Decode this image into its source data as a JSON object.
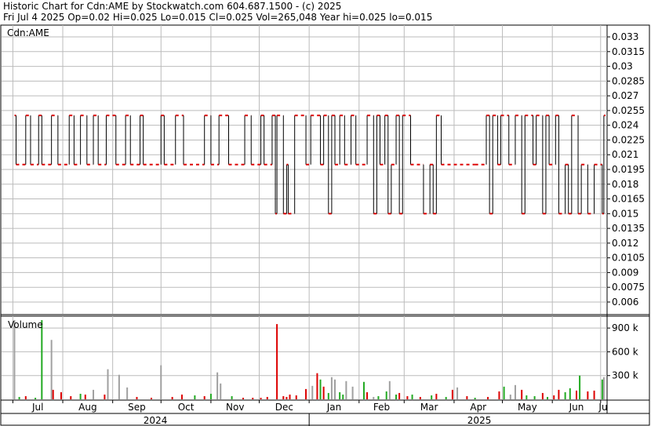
{
  "header": {
    "title_line": "Historic Chart for Cdn:AME by Stockwatch.com 604.687.1500 - (c) 2025",
    "stats_line": "Fri Jul  4 2025   Op=0.02   Hi=0.025   Lo=0.015   Cl=0.025   Vol=265,048   Year hi=0.025   lo=0.015"
  },
  "colors": {
    "up": "#dd0000",
    "down": "#000000",
    "vol_up": "#22aa22",
    "vol_down": "#dd0000",
    "vol_flat": "#a0a0a0",
    "grid": "#bbbbbb"
  },
  "chart_data": {
    "type": "ohlc",
    "symbol_label": "Cdn:AME",
    "price_axis": {
      "ticks": [
        "0.033",
        "0.0315",
        "0.03",
        "0.0285",
        "0.027",
        "0.0255",
        "0.024",
        "0.0225",
        "0.021",
        "0.0195",
        "0.018",
        "0.0165",
        "0.015",
        "0.0135",
        "0.012",
        "0.0105",
        "0.009",
        "0.0075",
        "0.006"
      ],
      "range": [
        0.0048,
        0.0342
      ]
    },
    "volume_axis": {
      "label": "Volume",
      "ticks": [
        "900 k",
        "600 k",
        "300 k"
      ],
      "range": [
        0,
        1050000
      ]
    },
    "months": [
      "Jul",
      "Aug",
      "Sep",
      "Oct",
      "Nov",
      "Dec",
      "Jan",
      "Feb",
      "Mar",
      "Apr",
      "May",
      "Jun",
      "Ju"
    ],
    "years": [
      "2024",
      "2025"
    ],
    "price_levels": [
      0.015,
      0.02,
      0.025
    ],
    "price_path": [
      [
        "2024-07-02",
        0.025
      ],
      [
        "2024-07-03",
        0.02
      ],
      [
        "2024-07-09",
        0.025
      ],
      [
        "2024-07-12",
        0.02
      ],
      [
        "2024-07-17",
        0.025
      ],
      [
        "2024-07-19",
        0.02
      ],
      [
        "2024-07-25",
        0.025
      ],
      [
        "2024-07-29",
        0.02
      ],
      [
        "2024-08-05",
        0.025
      ],
      [
        "2024-08-08",
        0.02
      ],
      [
        "2024-08-12",
        0.025
      ],
      [
        "2024-08-16",
        0.02
      ],
      [
        "2024-08-20",
        0.025
      ],
      [
        "2024-08-23",
        0.02
      ],
      [
        "2024-08-28",
        0.025
      ],
      [
        "2024-09-03",
        0.02
      ],
      [
        "2024-09-09",
        0.025
      ],
      [
        "2024-09-12",
        0.02
      ],
      [
        "2024-09-18",
        0.025
      ],
      [
        "2024-09-20",
        0.02
      ],
      [
        "2024-10-01",
        0.025
      ],
      [
        "2024-10-03",
        0.02
      ],
      [
        "2024-10-10",
        0.025
      ],
      [
        "2024-10-15",
        0.02
      ],
      [
        "2024-10-28",
        0.025
      ],
      [
        "2024-11-01",
        0.02
      ],
      [
        "2024-11-06",
        0.025
      ],
      [
        "2024-11-12",
        0.02
      ],
      [
        "2024-11-22",
        0.025
      ],
      [
        "2024-11-26",
        0.02
      ],
      [
        "2024-12-02",
        0.025
      ],
      [
        "2024-12-04",
        0.02
      ],
      [
        "2024-12-09",
        0.025
      ],
      [
        "2024-12-11",
        0.015
      ],
      [
        "2024-12-12",
        0.025
      ],
      [
        "2024-12-16",
        0.015
      ],
      [
        "2024-12-18",
        0.02
      ],
      [
        "2024-12-19",
        0.015
      ],
      [
        "2024-12-23",
        0.025
      ],
      [
        "2024-12-30",
        0.02
      ],
      [
        "2025-01-02",
        0.025
      ],
      [
        "2025-01-08",
        0.02
      ],
      [
        "2025-01-10",
        0.025
      ],
      [
        "2025-01-13",
        0.015
      ],
      [
        "2025-01-15",
        0.025
      ],
      [
        "2025-01-17",
        0.02
      ],
      [
        "2025-01-20",
        0.025
      ],
      [
        "2025-01-23",
        0.02
      ],
      [
        "2025-01-27",
        0.025
      ],
      [
        "2025-01-30",
        0.02
      ],
      [
        "2025-02-06",
        0.025
      ],
      [
        "2025-02-10",
        0.015
      ],
      [
        "2025-02-12",
        0.025
      ],
      [
        "2025-02-14",
        0.02
      ],
      [
        "2025-02-17",
        0.025
      ],
      [
        "2025-02-19",
        0.015
      ],
      [
        "2025-02-21",
        0.02
      ],
      [
        "2025-02-24",
        0.025
      ],
      [
        "2025-02-26",
        0.015
      ],
      [
        "2025-02-28",
        0.025
      ],
      [
        "2025-03-05",
        0.02
      ],
      [
        "2025-03-13",
        0.015
      ],
      [
        "2025-03-17",
        0.02
      ],
      [
        "2025-03-19",
        0.015
      ],
      [
        "2025-03-21",
        0.025
      ],
      [
        "2025-03-24",
        0.02
      ],
      [
        "2025-04-14",
        0.02
      ],
      [
        "2025-04-21",
        0.025
      ],
      [
        "2025-04-23",
        0.015
      ],
      [
        "2025-04-25",
        0.025
      ],
      [
        "2025-04-28",
        0.02
      ],
      [
        "2025-04-30",
        0.025
      ],
      [
        "2025-05-05",
        0.02
      ],
      [
        "2025-05-09",
        0.025
      ],
      [
        "2025-05-13",
        0.015
      ],
      [
        "2025-05-15",
        0.025
      ],
      [
        "2025-05-20",
        0.02
      ],
      [
        "2025-05-22",
        0.025
      ],
      [
        "2025-05-26",
        0.015
      ],
      [
        "2025-05-28",
        0.025
      ],
      [
        "2025-05-30",
        0.02
      ],
      [
        "2025-06-03",
        0.025
      ],
      [
        "2025-06-05",
        0.015
      ],
      [
        "2025-06-09",
        0.02
      ],
      [
        "2025-06-11",
        0.015
      ],
      [
        "2025-06-13",
        0.025
      ],
      [
        "2025-06-17",
        0.015
      ],
      [
        "2025-06-19",
        0.02
      ],
      [
        "2025-06-23",
        0.015
      ],
      [
        "2025-06-27",
        0.02
      ],
      [
        "2025-07-02",
        0.015
      ],
      [
        "2025-07-03",
        0.025
      ],
      [
        "2025-07-04",
        0.025
      ]
    ],
    "volume_bars": [
      [
        "2024-07-02",
        1000000,
        "flat"
      ],
      [
        "2024-07-05",
        30000,
        "up"
      ],
      [
        "2024-07-09",
        40000,
        "down"
      ],
      [
        "2024-07-15",
        20000,
        "up"
      ],
      [
        "2024-07-19",
        1000000,
        "up"
      ],
      [
        "2024-07-25",
        750000,
        "flat"
      ],
      [
        "2024-07-26",
        120000,
        "down"
      ],
      [
        "2024-07-31",
        90000,
        "down"
      ],
      [
        "2024-08-06",
        40000,
        "down"
      ],
      [
        "2024-08-12",
        70000,
        "up"
      ],
      [
        "2024-08-15",
        60000,
        "down"
      ],
      [
        "2024-08-20",
        120000,
        "flat"
      ],
      [
        "2024-08-27",
        60000,
        "down"
      ],
      [
        "2024-08-29",
        380000,
        "flat"
      ],
      [
        "2024-09-05",
        310000,
        "flat"
      ],
      [
        "2024-09-10",
        150000,
        "flat"
      ],
      [
        "2024-09-16",
        30000,
        "down"
      ],
      [
        "2024-09-25",
        20000,
        "down"
      ],
      [
        "2024-10-01",
        430000,
        "flat"
      ],
      [
        "2024-10-08",
        30000,
        "down"
      ],
      [
        "2024-10-14",
        60000,
        "down"
      ],
      [
        "2024-10-22",
        50000,
        "up"
      ],
      [
        "2024-10-28",
        40000,
        "down"
      ],
      [
        "2024-11-01",
        70000,
        "up"
      ],
      [
        "2024-11-05",
        340000,
        "flat"
      ],
      [
        "2024-11-07",
        200000,
        "flat"
      ],
      [
        "2024-11-14",
        40000,
        "up"
      ],
      [
        "2024-11-21",
        20000,
        "down"
      ],
      [
        "2024-11-27",
        20000,
        "down"
      ],
      [
        "2024-12-02",
        20000,
        "down"
      ],
      [
        "2024-12-06",
        30000,
        "down"
      ],
      [
        "2024-12-12",
        950000,
        "down"
      ],
      [
        "2024-12-16",
        40000,
        "down"
      ],
      [
        "2024-12-18",
        30000,
        "down"
      ],
      [
        "2024-12-20",
        60000,
        "down"
      ],
      [
        "2024-12-24",
        50000,
        "down"
      ],
      [
        "2024-12-30",
        130000,
        "down"
      ],
      [
        "2025-01-03",
        170000,
        "flat"
      ],
      [
        "2025-01-06",
        330000,
        "down"
      ],
      [
        "2025-01-08",
        250000,
        "up"
      ],
      [
        "2025-01-10",
        160000,
        "down"
      ],
      [
        "2025-01-13",
        80000,
        "up"
      ],
      [
        "2025-01-15",
        280000,
        "flat"
      ],
      [
        "2025-01-17",
        250000,
        "flat"
      ],
      [
        "2025-01-20",
        90000,
        "up"
      ],
      [
        "2025-01-22",
        60000,
        "up"
      ],
      [
        "2025-01-24",
        230000,
        "flat"
      ],
      [
        "2025-01-28",
        160000,
        "flat"
      ],
      [
        "2025-02-04",
        220000,
        "up"
      ],
      [
        "2025-02-06",
        90000,
        "down"
      ],
      [
        "2025-02-10",
        30000,
        "flat"
      ],
      [
        "2025-02-13",
        40000,
        "up"
      ],
      [
        "2025-02-18",
        100000,
        "up"
      ],
      [
        "2025-02-20",
        230000,
        "flat"
      ],
      [
        "2025-02-24",
        60000,
        "up"
      ],
      [
        "2025-02-26",
        80000,
        "down"
      ],
      [
        "2025-03-03",
        40000,
        "down"
      ],
      [
        "2025-03-06",
        60000,
        "up"
      ],
      [
        "2025-03-11",
        30000,
        "down"
      ],
      [
        "2025-03-18",
        50000,
        "up"
      ],
      [
        "2025-03-21",
        70000,
        "down"
      ],
      [
        "2025-03-27",
        30000,
        "up"
      ],
      [
        "2025-03-31",
        120000,
        "down"
      ],
      [
        "2025-04-03",
        150000,
        "flat"
      ],
      [
        "2025-04-09",
        40000,
        "down"
      ],
      [
        "2025-04-14",
        20000,
        "up"
      ],
      [
        "2025-04-22",
        30000,
        "down"
      ],
      [
        "2025-04-29",
        100000,
        "down"
      ],
      [
        "2025-05-02",
        160000,
        "up"
      ],
      [
        "2025-05-06",
        60000,
        "flat"
      ],
      [
        "2025-05-09",
        180000,
        "flat"
      ],
      [
        "2025-05-13",
        120000,
        "down"
      ],
      [
        "2025-05-16",
        50000,
        "up"
      ],
      [
        "2025-05-21",
        40000,
        "up"
      ],
      [
        "2025-05-26",
        80000,
        "down"
      ],
      [
        "2025-05-29",
        30000,
        "up"
      ],
      [
        "2025-06-02",
        50000,
        "down"
      ],
      [
        "2025-06-05",
        120000,
        "down"
      ],
      [
        "2025-06-09",
        90000,
        "up"
      ],
      [
        "2025-06-12",
        140000,
        "up"
      ],
      [
        "2025-06-16",
        110000,
        "down"
      ],
      [
        "2025-06-18",
        300000,
        "up"
      ],
      [
        "2025-06-23",
        100000,
        "down"
      ],
      [
        "2025-06-27",
        110000,
        "down"
      ],
      [
        "2025-07-02",
        250000,
        "up"
      ],
      [
        "2025-07-03",
        280000,
        "flat"
      ]
    ]
  }
}
